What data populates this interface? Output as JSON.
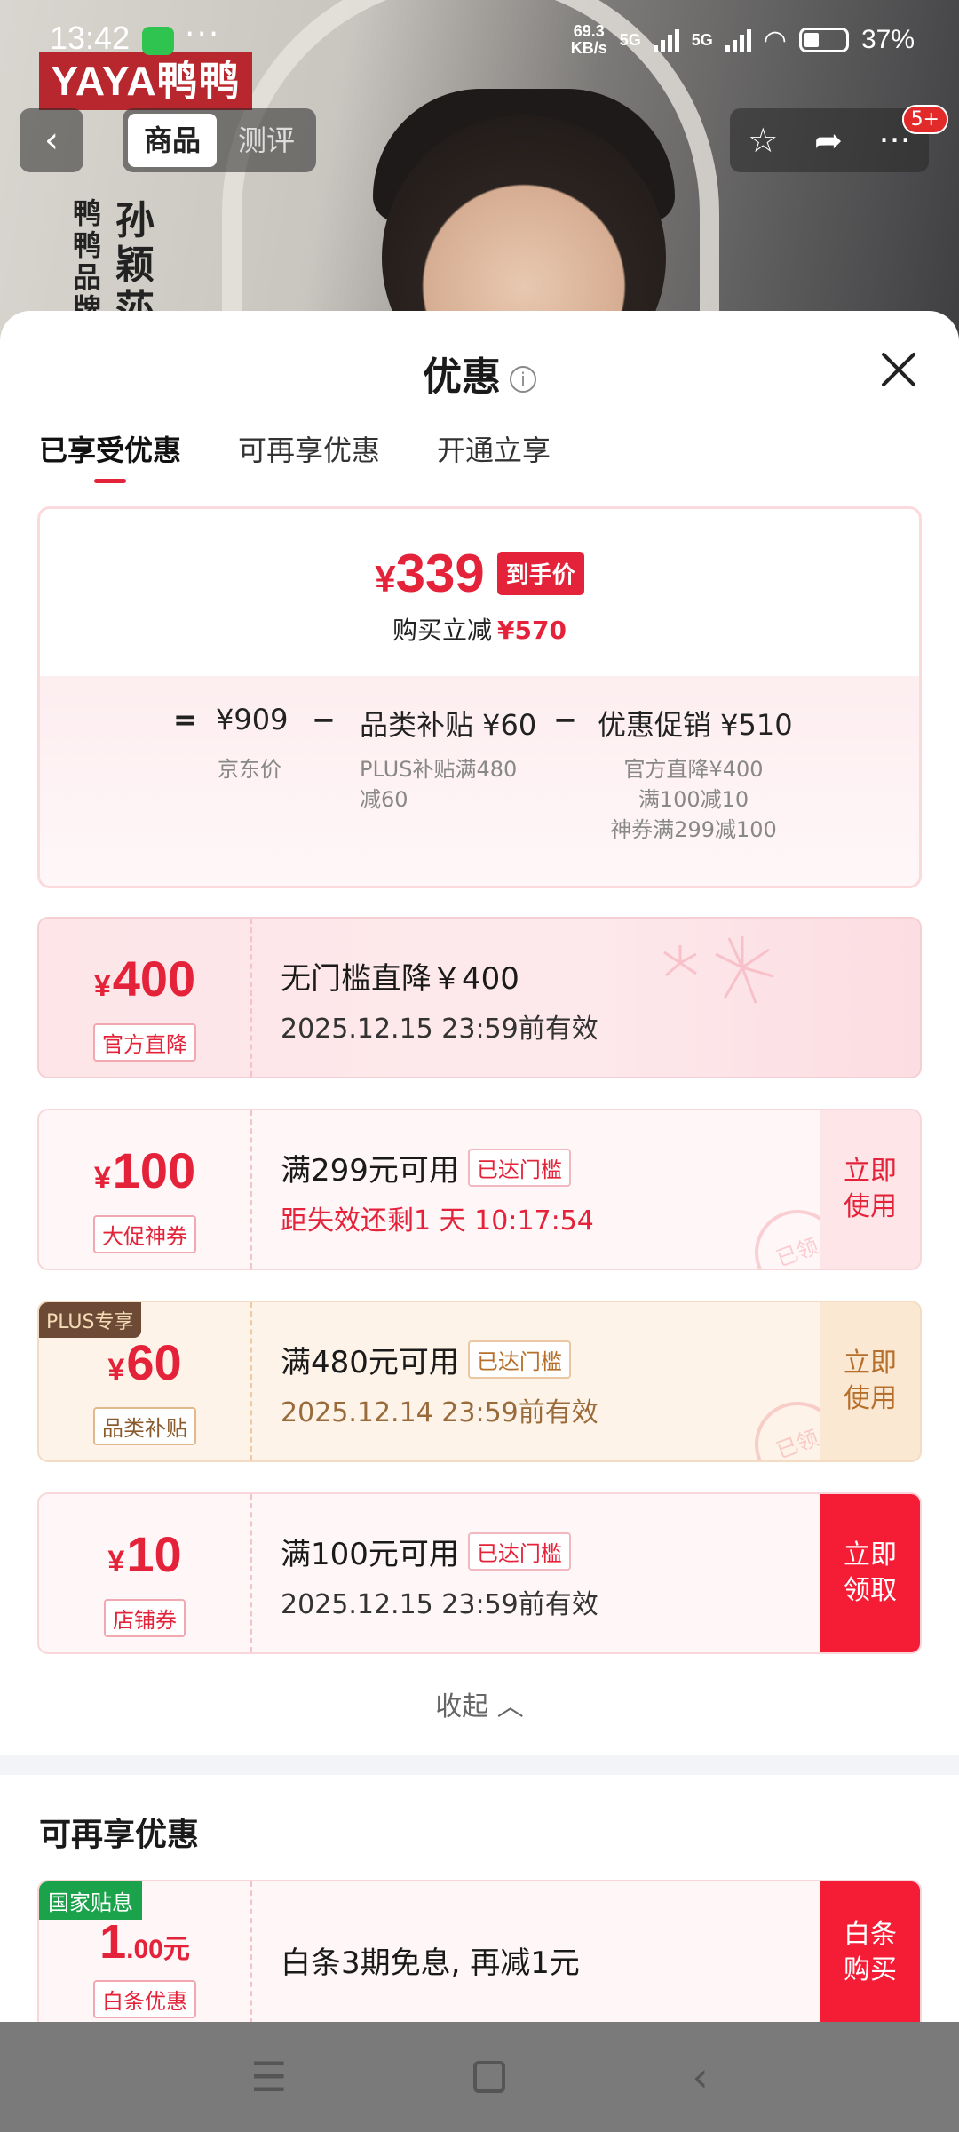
{
  "status_bar": {
    "time": "13:42",
    "speed_value": "69.3",
    "speed_unit": "KB/s",
    "net1": "5G",
    "net2": "5G",
    "battery": "37%"
  },
  "background": {
    "brand_logo": "YAYA鸭鸭",
    "brand_text1": "鸭鸭品牌",
    "brand_text2": "孙颖莎"
  },
  "nav": {
    "back_icon": "chevron-left-icon",
    "tabs": [
      "商品",
      "测评"
    ],
    "active_tab": "商品",
    "badge": "5+"
  },
  "sheet": {
    "title": "优惠",
    "tabs": [
      "已享受优惠",
      "可再享优惠",
      "开通立享"
    ],
    "summary": {
      "price_symbol": "¥",
      "price": "339",
      "price_tag": "到手价",
      "save_label": "购买立减",
      "save_value": "¥570",
      "eq": "=",
      "jd_price": "¥909",
      "jd_label": "京东价",
      "minus1": "−",
      "subsidy": "品类补贴 ¥60",
      "subsidy_note1": "PLUS补贴满480",
      "subsidy_note2": "减60",
      "minus2": "−",
      "promo": "优惠促销 ¥510",
      "promo_note1": "官方直降¥400",
      "promo_note2": "满100减10",
      "promo_note3": "神券满299减100"
    },
    "coupons": [
      {
        "symbol": "¥",
        "amount": "400",
        "label": "官方直降",
        "condition": "无门槛直降￥400",
        "expiry": "2025.12.15 23:59前有效"
      },
      {
        "symbol": "¥",
        "amount": "100",
        "label": "大促神券",
        "condition": "满299元可用",
        "chip": "已达门槛",
        "expiry": "距失效还剩1 天 10:17:54",
        "action": "立即\n使用",
        "stamp": "已领"
      },
      {
        "badge": "PLUS专享",
        "symbol": "¥",
        "amount": "60",
        "label": "品类补贴",
        "condition": "满480元可用",
        "chip": "已达门槛",
        "expiry": "2025.12.14 23:59前有效",
        "action": "立即\n使用",
        "stamp": "已领"
      },
      {
        "symbol": "¥",
        "amount": "10",
        "label": "店铺券",
        "condition": "满100元可用",
        "chip": "已达门槛",
        "expiry": "2025.12.15 23:59前有效",
        "action": "立即\n领取"
      }
    ],
    "collapse": "收起",
    "more_section": {
      "title": "可再享优惠",
      "coupon": {
        "badge": "国家贴息",
        "amount_int": "1",
        "amount_dec": ".00元",
        "label": "白条优惠",
        "condition": "白条3期免息, 再减1元",
        "action": "白条\n购买"
      }
    }
  },
  "colors": {
    "accent": "#e4233a",
    "cta": "#f51d36",
    "plus_gold": "#6c4a36",
    "green": "#1aa34a"
  }
}
